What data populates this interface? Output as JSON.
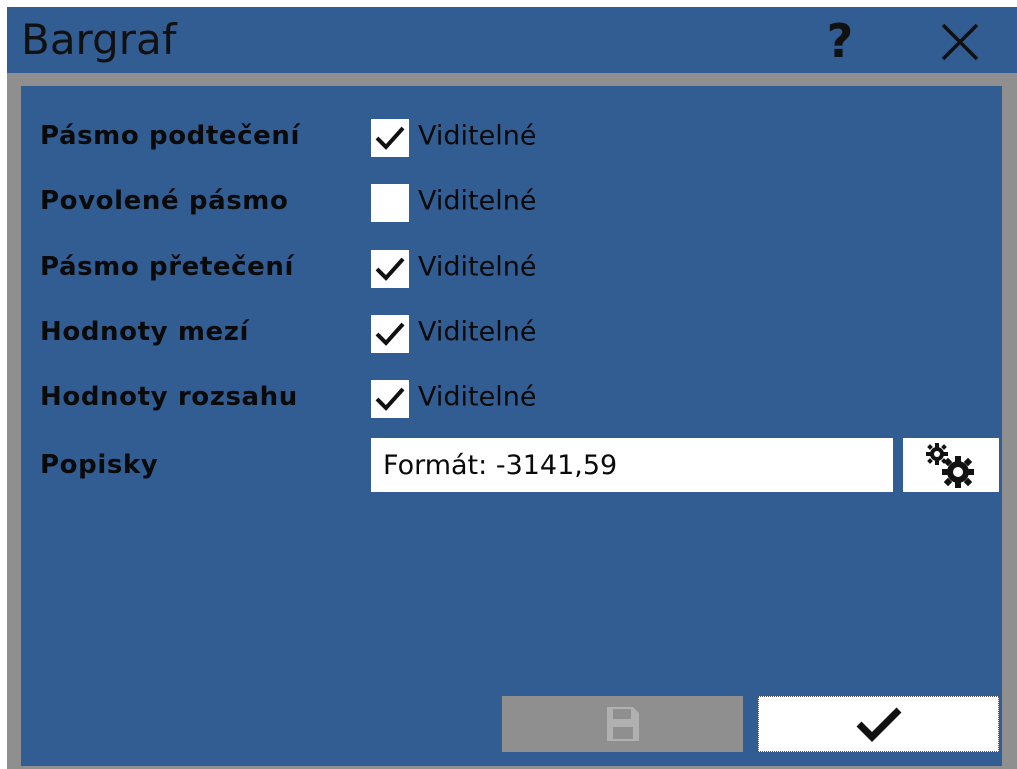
{
  "window": {
    "title": "Bargraf",
    "help_label": "?",
    "close_icon": "close-icon"
  },
  "rows": [
    {
      "label": "Pásmo podtečení",
      "option": "Viditelné",
      "checked": true
    },
    {
      "label": "Povolené pásmo",
      "option": "Viditelné",
      "checked": false
    },
    {
      "label": "Pásmo přetečení",
      "option": "Viditelné",
      "checked": true
    },
    {
      "label": "Hodnoty mezí",
      "option": "Viditelné",
      "checked": true
    },
    {
      "label": "Hodnoty rozsahu",
      "option": "Viditelné",
      "checked": true
    }
  ],
  "labels_row": {
    "label": "Popisky",
    "format_value": "Formát: -3141,59",
    "settings_icon": "gears-icon"
  },
  "footer": {
    "save_icon": "floppy-disk-icon",
    "save_enabled": false,
    "ok_icon": "checkmark-icon"
  },
  "colors": {
    "panel": "#325d93",
    "frame": "#8f8f8f",
    "field": "#ffffff",
    "text": "#0a0a0a"
  }
}
